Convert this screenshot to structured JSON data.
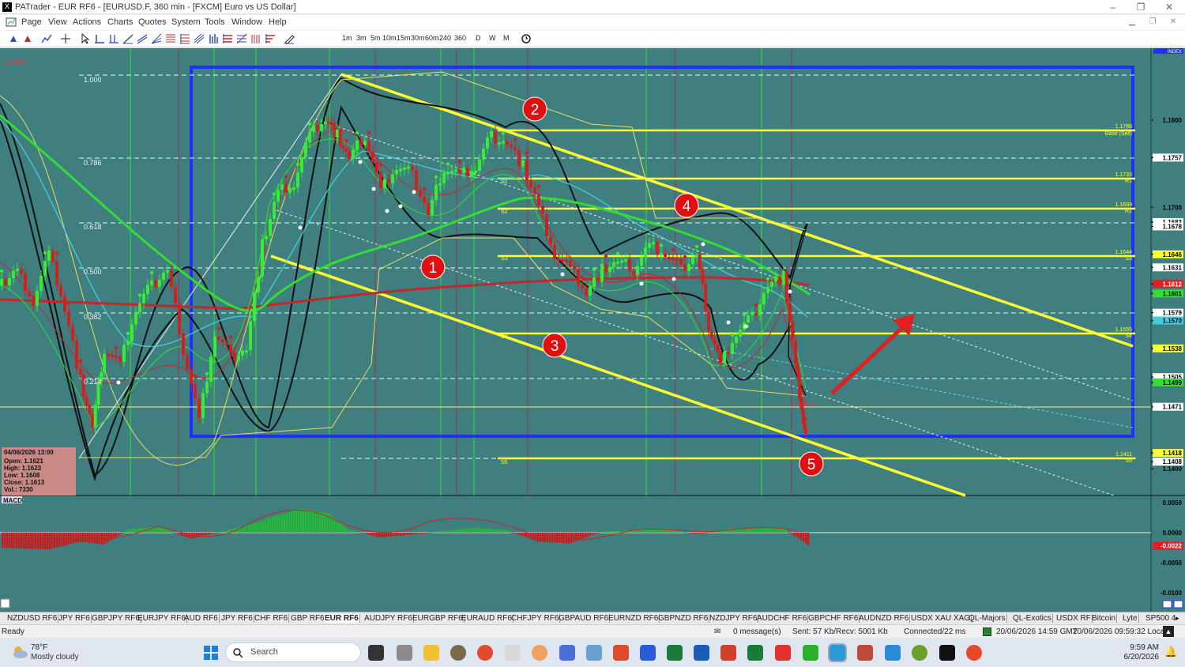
{
  "window": {
    "title": "PATrader - EUR RF6 - [EURUSD.F, 360 min - [FXCM] Euro vs US Dollar]",
    "min": "–",
    "max": "❐",
    "close": "✕"
  },
  "menu": [
    "Page",
    "View",
    "Actions",
    "Charts",
    "Quotes",
    "System",
    "Tools",
    "Window",
    "Help"
  ],
  "timeframes": [
    "1m",
    "3m",
    "5m",
    "10m",
    "15m",
    "30m",
    "60m",
    "240",
    "360",
    "D",
    "W",
    "M"
  ],
  "chart": {
    "locked_label": "Locked",
    "index_label": "INDEX",
    "fib_levels": [
      "1.000",
      "0.786",
      "0.618",
      "0.500",
      "0.382",
      "0.214"
    ],
    "price_axis": [
      "1.1800",
      "1.1757",
      "1.1700",
      "1.1683",
      "1.1678",
      "1.1646",
      "1.1631",
      "1.1612",
      "1.1601",
      "1.1579",
      "1.1570",
      "1.1538",
      "1.1505",
      "1.1499",
      "1.1471",
      "1.1418",
      "1.1408",
      "1.1400"
    ],
    "pivot_labels": {
      "r_top": "1.1788",
      "base_sell": "Base (Sell)",
      "r1_val": "1.1733",
      "r1": "R1",
      "r2_val": "1.1699",
      "r2": "R2",
      "s1": "S1",
      "s2": "S2",
      "s3_val": "1.1644",
      "s3": "S3",
      "s4_val": "1.1555",
      "s4": "S4",
      "s5_val": "1.1411",
      "s5": "S5",
      "s1_left": "S1",
      "s2_left": "S2",
      "s3_left": "S3",
      "s4_left": "S4",
      "s5_left": "S5",
      "base_buy": "Buy Base"
    },
    "markers": [
      "1",
      "2",
      "3",
      "4",
      "5"
    ],
    "ohlc": {
      "date": "04/06/2026 13:00",
      "open": "Open: 1.1621",
      "high": "High: 1.1623",
      "low": "Low: 1.1608",
      "close": "Close: 1.1613",
      "vol": "Vol.: 7330"
    },
    "macd_label": "MACD",
    "macd_axis": [
      "0.0050",
      "0.0000",
      "-0.0022",
      "-0.0050",
      "-0.0100"
    ],
    "colors": {
      "background": "#3f7f7f",
      "box": "#1f2fff",
      "trend": "#ffff33",
      "ma_red": "#c0282a",
      "ma_green": "#33dd33",
      "arrow": "#e02020",
      "marker": "#e01010"
    }
  },
  "tabs": [
    "NZDUSD RF6",
    "JPY RF6",
    "GBPJPY RF6",
    "EURJPY RF6",
    "AUD RF6",
    "JPY RF6",
    "CHF RF6",
    "GBP RF6",
    "EUR RF6",
    "AUDJPY RF6",
    "EURGBP RF6",
    "EURAUD RF6",
    "CHFJPY RF6",
    "GBPAUD RF6",
    "EURNZD RF6",
    "GBPNZD RF6",
    "NZDJPY RF6",
    "AUDCHF RF6",
    "GBPCHF RF6",
    "AUDNZD RF6",
    "USDX XAU XAG",
    "QL-Majors",
    "QL-Exotics",
    "USDX RF",
    "Bitcoin",
    "Lyte",
    "SP500 4"
  ],
  "active_tab": "EUR RF6",
  "status": {
    "ready": "Ready",
    "messages": "0 message(s)",
    "traffic": "Sent: 57 Kb/Recv: 5001 Kb",
    "connection": "Connected/22 ms",
    "gmt": "20/06/2026 14:59 GMT",
    "local": "20/06/2026 09:59:32 Local"
  },
  "taskbar": {
    "weather_temp": "78°F",
    "weather_desc": "Mostly cloudy",
    "search": "Search",
    "time": "9:59 AM",
    "date": "6/20/2026"
  }
}
